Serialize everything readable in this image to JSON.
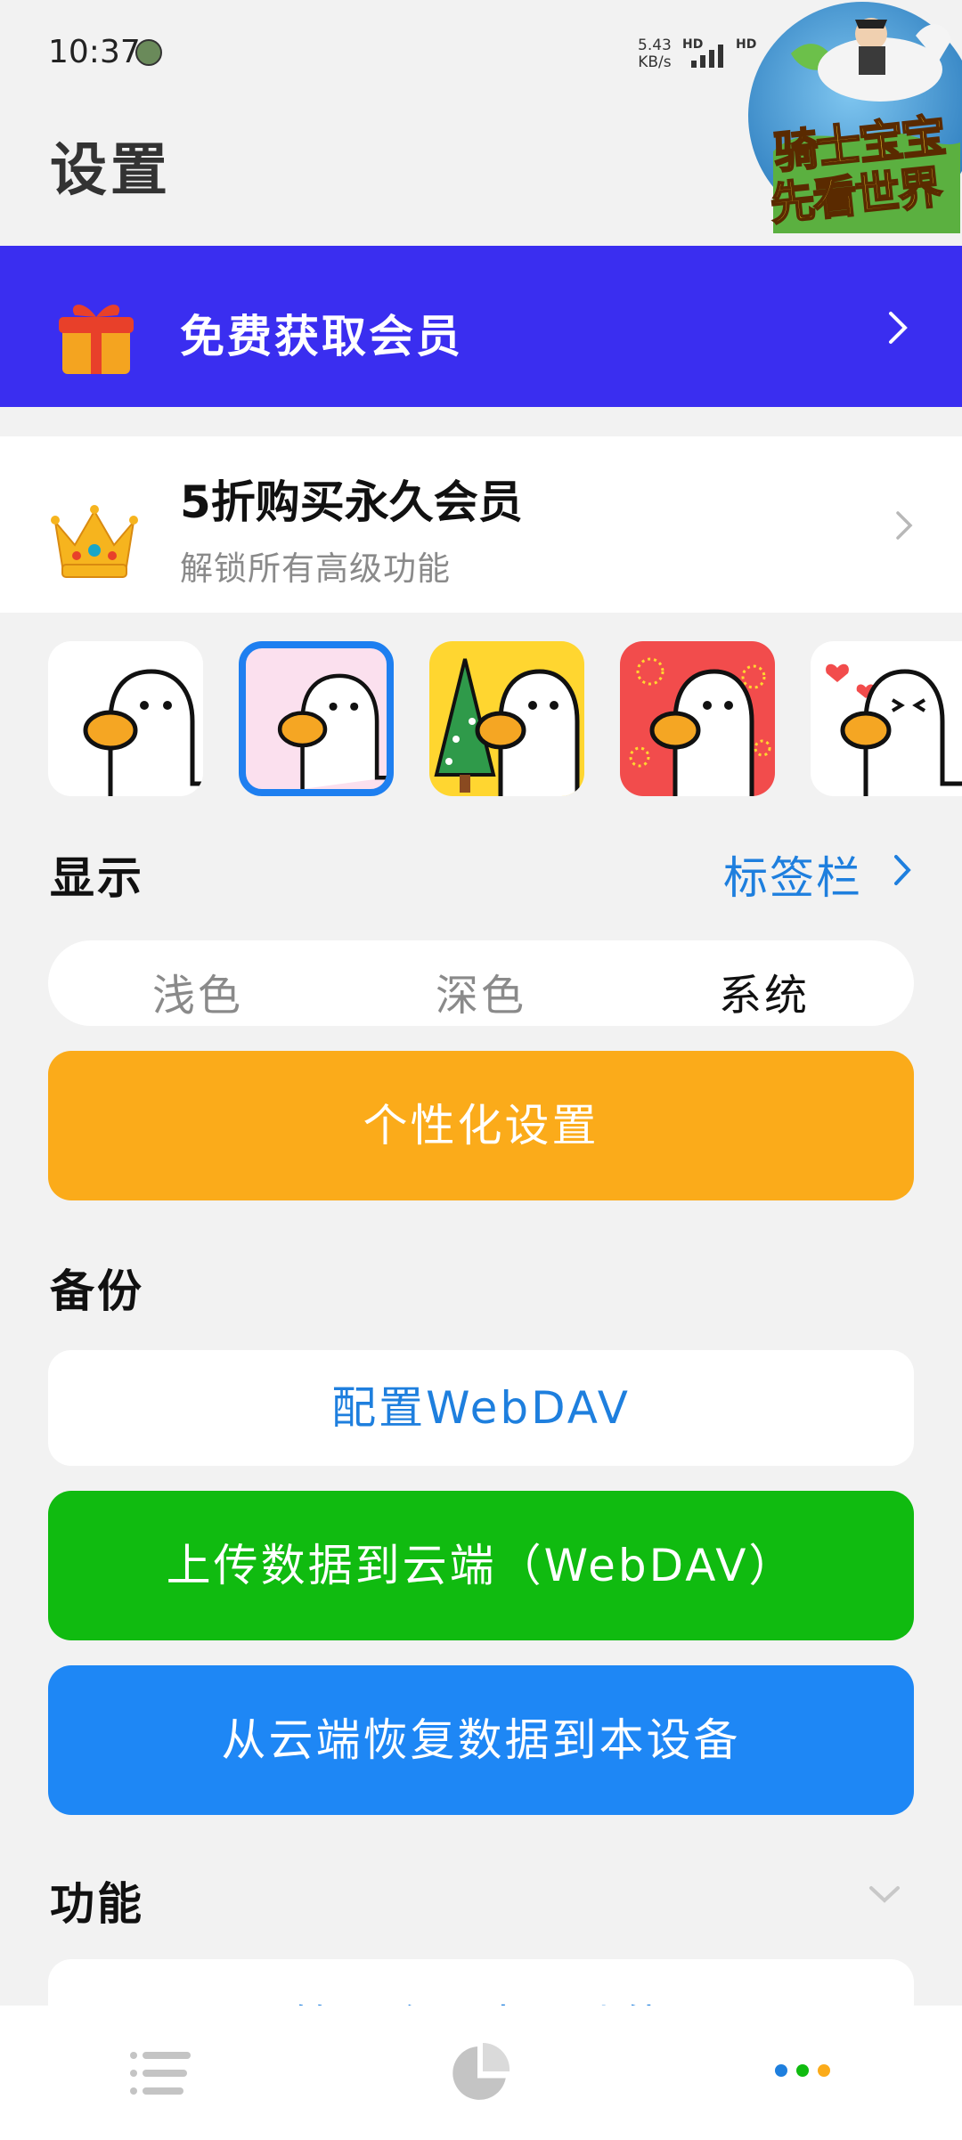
{
  "status_bar": {
    "time": "10:37",
    "net_speed_value": "5.43",
    "net_speed_unit": "KB/s",
    "hd1": "HD",
    "hd2": "HD",
    "app_icon": "app-notification-icon",
    "signal_icon": "signal-bars-icon"
  },
  "overlay_ad": {
    "line1": "骑士宝宝",
    "line2": "先看世界"
  },
  "header": {
    "title": "设置"
  },
  "free_member": {
    "label": "免费获取会员",
    "icon": "gift-icon",
    "bg_color": "#3a2ef0"
  },
  "buy_permanent": {
    "title": "5折购买永久会员",
    "subtitle": "解锁所有高级功能",
    "icon": "crown-icon"
  },
  "themes": [
    {
      "name": "duck-white",
      "selected": false
    },
    {
      "name": "duck-pink",
      "selected": true
    },
    {
      "name": "duck-christmas",
      "selected": false
    },
    {
      "name": "duck-red-festive",
      "selected": false
    },
    {
      "name": "duck-hearts",
      "selected": false
    }
  ],
  "display": {
    "section_title": "显示",
    "tab_bar_link": "标签栏",
    "modes": [
      "浅色",
      "深色",
      "系统"
    ],
    "selected_mode": "系统",
    "personalize_button": "个性化设置",
    "personalize_color": "#fbab1a"
  },
  "backup": {
    "section_title": "备份",
    "configure_button": "配置WebDAV",
    "upload_button": "上传数据到云端（WebDAV）",
    "restore_button": "从云端恢复数据到本设备",
    "upload_color": "#10bb10",
    "restore_color": "#1e87f5"
  },
  "features": {
    "section_title": "功能",
    "first_item_partial": "管理会员中心功能"
  },
  "bottom_nav": {
    "items": [
      "list-icon",
      "pie-chart-icon",
      "more-dots-icon"
    ]
  }
}
